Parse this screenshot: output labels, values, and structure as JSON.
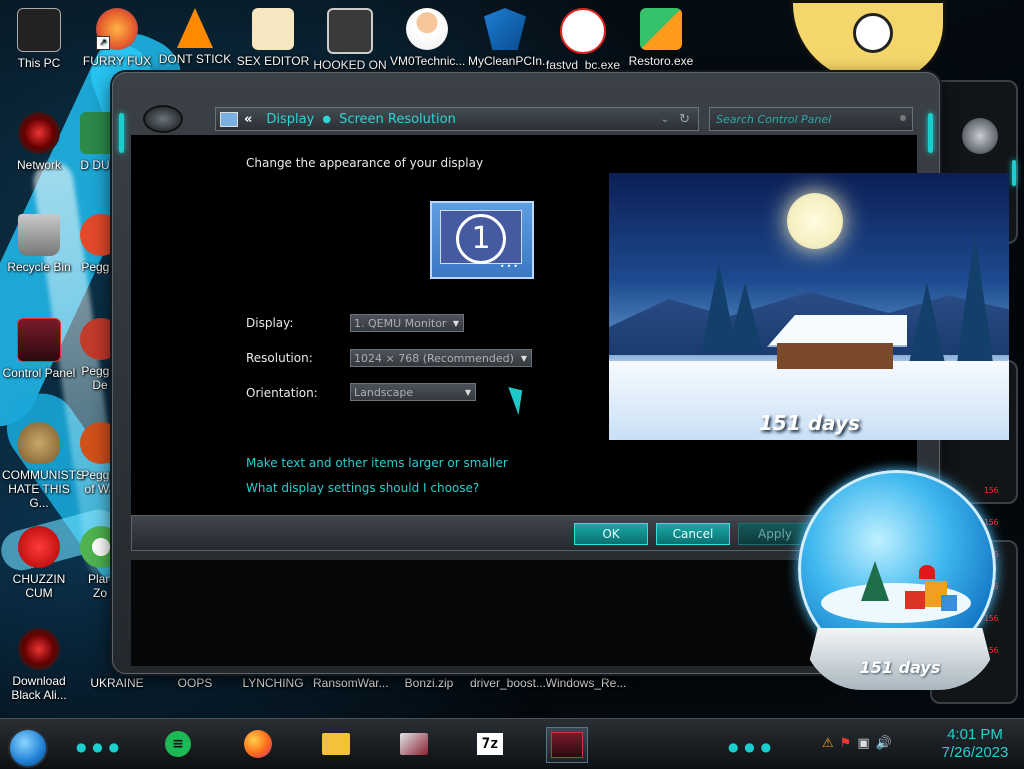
{
  "desktop": {
    "icons": [
      {
        "label": "This PC",
        "icon": "computer-icon"
      },
      {
        "label": "FURRY FUX",
        "icon": "firefox-icon"
      },
      {
        "label": "DONT STICK",
        "icon": "vlc-icon"
      },
      {
        "label": "SEX EDITOR",
        "icon": "hxd-icon"
      },
      {
        "label": "HOOKED ON",
        "icon": "maze-icon"
      },
      {
        "label": "VM0Technic...",
        "icon": "doctor-icon"
      },
      {
        "label": "MyCleanPCIn...",
        "icon": "shield-icon"
      },
      {
        "label": "fastvd_bc.exe",
        "icon": "video-downloader-icon"
      },
      {
        "label": "Restoro.exe",
        "icon": "restoro-icon"
      },
      {
        "label": "Network",
        "icon": "network-icon"
      },
      {
        "label": "D DUM",
        "icon": "file-icon"
      },
      {
        "label": "Recycle Bin",
        "icon": "recycle-bin-icon"
      },
      {
        "label": "Peggle",
        "icon": "peggle-icon"
      },
      {
        "label": "Control Panel",
        "icon": "control-panel-icon"
      },
      {
        "label": "Peggle De",
        "icon": "peggle-icon"
      },
      {
        "label": "COMMUNISTS HATE THIS G...",
        "icon": "money-bag-icon"
      },
      {
        "label": "Peggle of Wa",
        "icon": "peggle-icon"
      },
      {
        "label": "CHUZZIN CUM",
        "icon": "chuzzle-icon"
      },
      {
        "label": "Plan Zo",
        "icon": "plants-icon"
      },
      {
        "label": "Download Black Ali...",
        "icon": "alien-icon"
      },
      {
        "label": "UKRAINE",
        "icon": "app-icon"
      },
      {
        "label": "OOPS",
        "icon": "app-icon"
      },
      {
        "label": "LYNCHING",
        "icon": "app-icon"
      },
      {
        "label": "RansomWar...",
        "icon": "app-icon"
      },
      {
        "label": "Bonzi.zip",
        "icon": "zip-icon"
      },
      {
        "label": "driver_boost...",
        "icon": "app-icon"
      },
      {
        "label": "Windows_Re...",
        "icon": "app-icon"
      }
    ],
    "shortcut_arrow": "↗"
  },
  "window": {
    "breadcrumb": {
      "back_chevron": "«",
      "display": "Display",
      "separator": "●",
      "screen_resolution": "Screen Resolution",
      "dropdown": "⌄",
      "refresh": "↻"
    },
    "search": {
      "placeholder": "Search Control Panel"
    },
    "heading": "Change the appearance of your display",
    "monitor": {
      "number": "1",
      "dots": "•••"
    },
    "fields": {
      "display_label": "Display:",
      "display_value": "1. QEMU Monitor",
      "resolution_label": "Resolution:",
      "resolution_value": "1024 × 768 (Recommended)",
      "orientation_label": "Orientation:",
      "orientation_value": "Landscape"
    },
    "links": {
      "text_size": "Make text and other items larger or smaller",
      "display_help": "What display settings should I choose?"
    },
    "buttons": {
      "ok": "OK",
      "cancel": "Cancel",
      "apply": "Apply"
    }
  },
  "widgets": {
    "winter_days": "151 days",
    "globe_days": "151 days",
    "right_frame_codes": [
      "156",
      "156",
      "156",
      "156",
      "156",
      "156"
    ]
  },
  "taskbar": {
    "dots": "● ● ●",
    "spotify_glyph": "≡",
    "sevenzip_label": "7z",
    "tray_icons": [
      "⚠",
      "⚑",
      "▣",
      "🔊"
    ],
    "time": "4:01 PM",
    "date": "7/26/2023"
  },
  "colors": {
    "accent": "#26d0d0",
    "window_frame": "#3b4147",
    "button_teal": "#1aa8a8"
  }
}
